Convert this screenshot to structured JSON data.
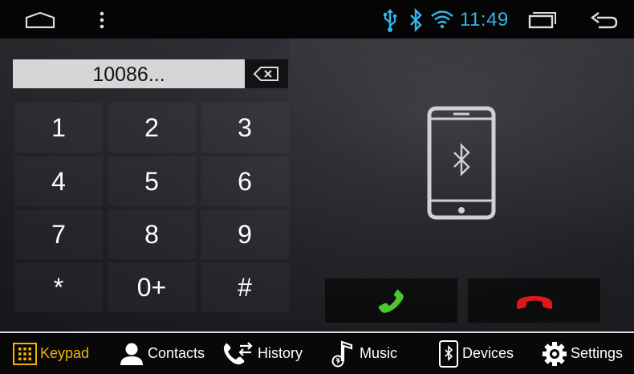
{
  "status_bar": {
    "time": "11:49",
    "icons": [
      "home-icon",
      "menu-icon",
      "usb-icon",
      "bluetooth-icon",
      "wifi-icon",
      "recent-apps-icon",
      "back-icon"
    ],
    "accent_color": "#33b5e5"
  },
  "dialer": {
    "number": "10086...",
    "keys": [
      "1",
      "2",
      "3",
      "4",
      "5",
      "6",
      "7",
      "8",
      "9",
      "*",
      "0+",
      "#"
    ],
    "call_color": "#4cc82f",
    "hangup_color": "#e01818"
  },
  "nav": {
    "items": [
      {
        "label": "Keypad",
        "icon": "keypad-icon",
        "active": true
      },
      {
        "label": "Contacts",
        "icon": "contact-icon",
        "active": false
      },
      {
        "label": "History",
        "icon": "call-history-icon",
        "active": false
      },
      {
        "label": "Music",
        "icon": "music-note-icon",
        "active": false
      },
      {
        "label": "Devices",
        "icon": "bluetooth-device-icon",
        "active": false
      },
      {
        "label": "Settings",
        "icon": "gear-icon",
        "active": false
      }
    ],
    "active_color": "#f0b400"
  }
}
